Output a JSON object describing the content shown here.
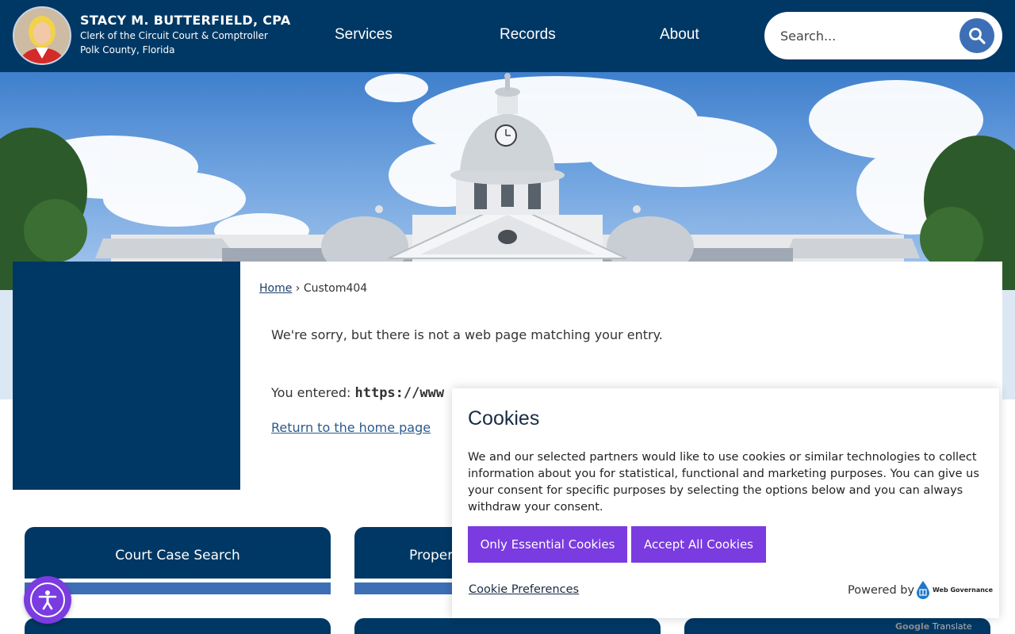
{
  "header": {
    "name": "STACY M. BUTTERFIELD, CPA",
    "subtitle": "Clerk of the Circuit Court & Comptroller",
    "location": "Polk County, Florida",
    "nav": [
      {
        "label": "Services"
      },
      {
        "label": "Records"
      },
      {
        "label": "About"
      }
    ],
    "search": {
      "placeholder": "Search..."
    }
  },
  "breadcrumb": {
    "home": "Home",
    "separator": "›",
    "current": "Custom404"
  },
  "content": {
    "sorry_text": "We're sorry, but there is not a web page matching your entry.",
    "entered_label": "You entered:",
    "entered_value": "https://www",
    "return_link": "Return to the home page"
  },
  "quick_links": [
    {
      "label": "Court Case Search"
    },
    {
      "label": "Proper"
    }
  ],
  "cookie_dialog": {
    "title": "Cookies",
    "text": "We and our selected partners would like to use cookies or similar technologies to collect information about you for statistical, functional and marketing purposes. You can give us your consent for specific purposes by selecting the options below and you can always withdraw your consent.",
    "essential_button": "Only Essential Cookies",
    "accept_button": "Accept All Cookies",
    "preferences_link": "Cookie Preferences",
    "powered_by": "Powered by",
    "brand": "Web Governance"
  },
  "translate": {
    "google": "Google",
    "translate": "Translate"
  },
  "icons": {
    "search": "search-icon",
    "accessibility": "accessibility-icon",
    "web_governance": "web-governance-logo"
  },
  "colors": {
    "navy": "#003865",
    "accent_blue": "#3d6fb6",
    "cookie_purple": "#7a3be0"
  }
}
